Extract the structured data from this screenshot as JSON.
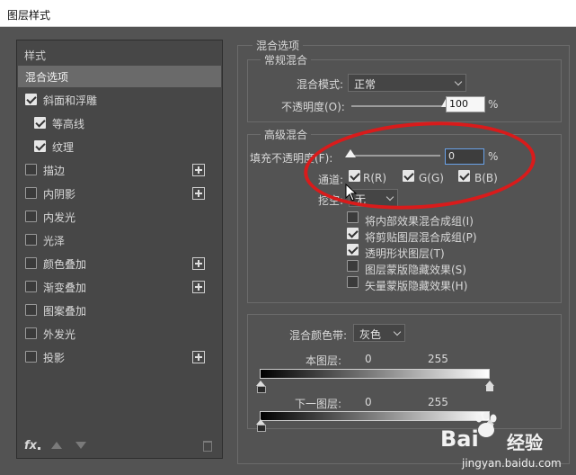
{
  "window": {
    "title": "图层样式"
  },
  "left": {
    "header": "样式",
    "items": [
      {
        "label": "混合选项",
        "checkbox": null,
        "checked": false,
        "plus": false,
        "selected": true,
        "indent": 0
      },
      {
        "label": "斜面和浮雕",
        "checkbox": true,
        "checked": true,
        "plus": false,
        "selected": false,
        "indent": 0
      },
      {
        "label": "等高线",
        "checkbox": true,
        "checked": true,
        "plus": false,
        "selected": false,
        "indent": 1
      },
      {
        "label": "纹理",
        "checkbox": true,
        "checked": true,
        "plus": false,
        "selected": false,
        "indent": 1
      },
      {
        "label": "描边",
        "checkbox": true,
        "checked": false,
        "plus": true,
        "selected": false,
        "indent": 0
      },
      {
        "label": "内阴影",
        "checkbox": true,
        "checked": false,
        "plus": true,
        "selected": false,
        "indent": 0
      },
      {
        "label": "内发光",
        "checkbox": true,
        "checked": false,
        "plus": false,
        "selected": false,
        "indent": 0
      },
      {
        "label": "光泽",
        "checkbox": true,
        "checked": false,
        "plus": false,
        "selected": false,
        "indent": 0
      },
      {
        "label": "颜色叠加",
        "checkbox": true,
        "checked": false,
        "plus": true,
        "selected": false,
        "indent": 0
      },
      {
        "label": "渐变叠加",
        "checkbox": true,
        "checked": false,
        "plus": true,
        "selected": false,
        "indent": 0
      },
      {
        "label": "图案叠加",
        "checkbox": true,
        "checked": false,
        "plus": false,
        "selected": false,
        "indent": 0
      },
      {
        "label": "外发光",
        "checkbox": true,
        "checked": false,
        "plus": false,
        "selected": false,
        "indent": 0
      },
      {
        "label": "投影",
        "checkbox": true,
        "checked": false,
        "plus": true,
        "selected": false,
        "indent": 0
      }
    ],
    "footer": {
      "fx_label": "fx"
    }
  },
  "blend": {
    "section_title": "混合选项",
    "general": {
      "title": "常规混合",
      "mode_label": "混合模式:",
      "mode_value": "正常",
      "opacity_label": "不透明度(O):",
      "opacity_value": "100",
      "opacity_fraction": 1.0,
      "percent": "%"
    },
    "advanced": {
      "title": "高级混合",
      "fill_label": "填充不透明度(F):",
      "fill_value": "0",
      "fill_fraction": 0.0,
      "percent": "%",
      "channels_label": "通道:",
      "channels": [
        {
          "label": "R(R)",
          "checked": true
        },
        {
          "label": "G(G)",
          "checked": true
        },
        {
          "label": "B(B)",
          "checked": true
        }
      ],
      "knockout_label": "挖空:",
      "knockout_value": "无",
      "options": [
        {
          "label": "将内部效果混合成组(I)",
          "checked": false
        },
        {
          "label": "将剪贴图层混合成组(P)",
          "checked": true
        },
        {
          "label": "透明形状图层(T)",
          "checked": true
        },
        {
          "label": "图层蒙版隐藏效果(S)",
          "checked": false
        },
        {
          "label": "矢量蒙版隐藏效果(H)",
          "checked": false
        }
      ]
    },
    "blend_if": {
      "label": "混合颜色带:",
      "value": "灰色",
      "this_layer_label": "本图层:",
      "this_min": "0",
      "this_max": "255",
      "under_layer_label": "下一图层:",
      "under_min": "0",
      "under_max": "255"
    }
  },
  "watermark": {
    "brand": "Bai",
    "brand_suffix": "经验",
    "url": "jingyan.baidu.com"
  },
  "colors": {
    "panel": "#535353",
    "list_bg": "#474747",
    "highlight": "#d91b1b",
    "focus": "#6aa2e8"
  }
}
